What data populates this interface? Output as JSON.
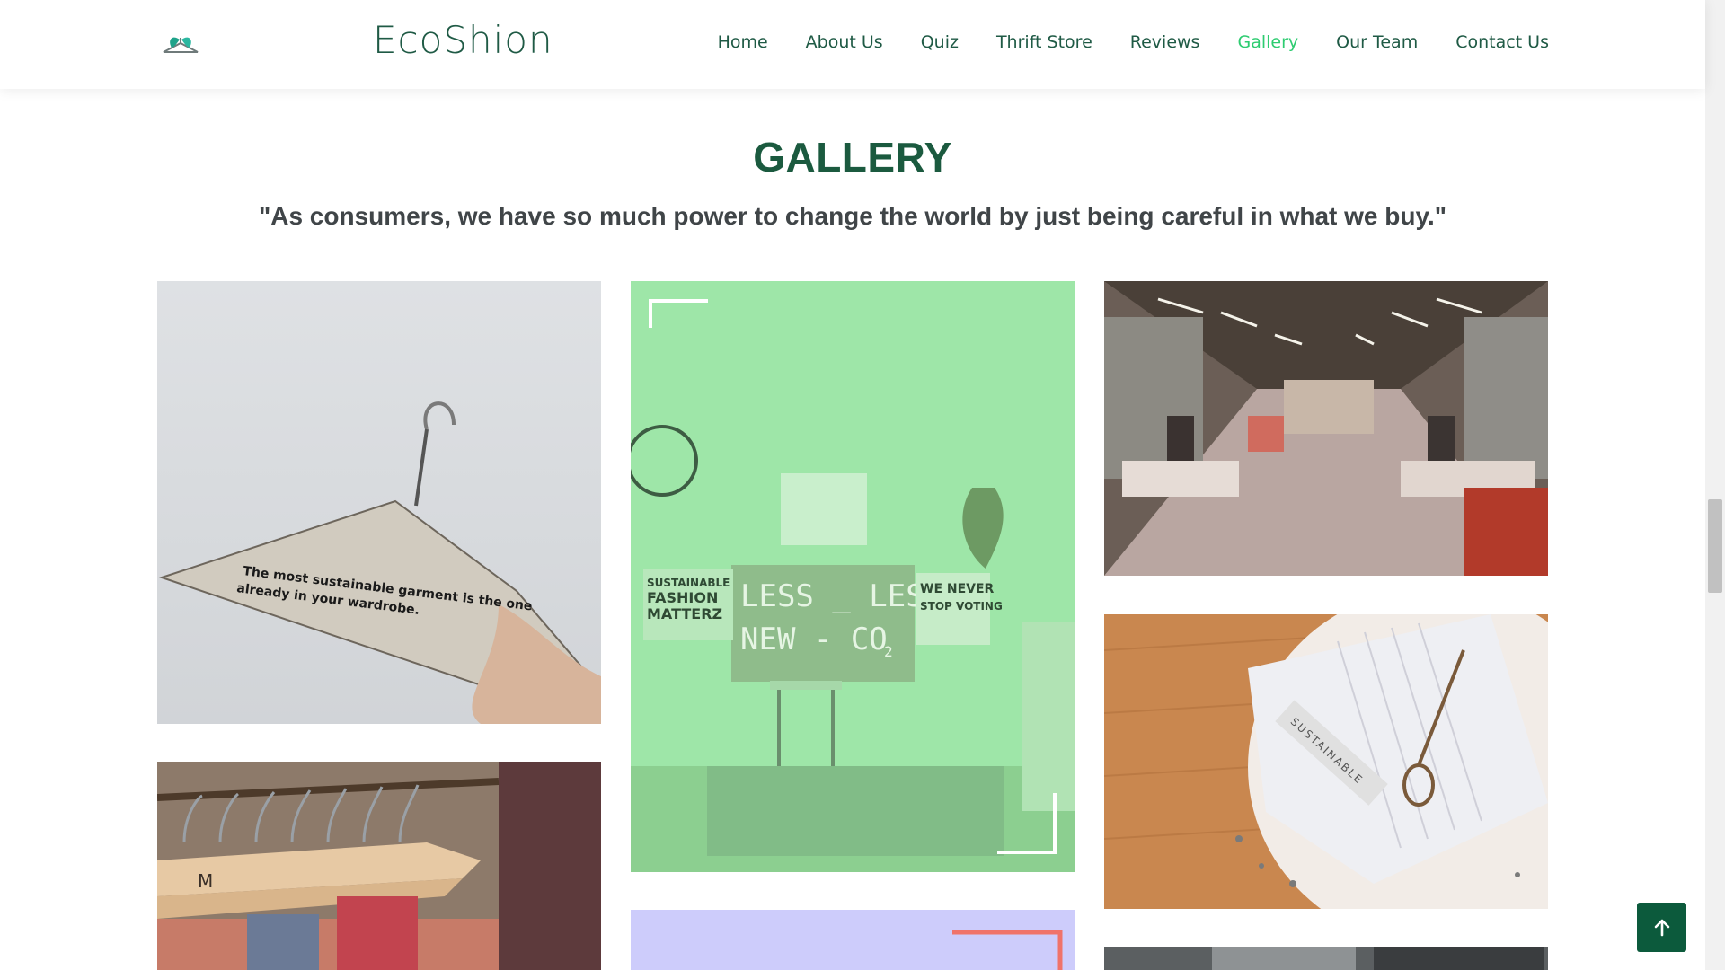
{
  "site": {
    "brand": "EcoShion",
    "logo_icon": "hanger-leaf-logo-icon"
  },
  "nav": {
    "items": [
      {
        "label": "Home",
        "active": false
      },
      {
        "label": "About Us",
        "active": false
      },
      {
        "label": "Quiz",
        "active": false
      },
      {
        "label": "Thrift Store",
        "active": false
      },
      {
        "label": "Reviews",
        "active": false
      },
      {
        "label": "Gallery",
        "active": true
      },
      {
        "label": "Our Team",
        "active": false
      },
      {
        "label": "Contact Us",
        "active": false
      }
    ]
  },
  "gallery": {
    "title": "GALLERY",
    "quote": "\"As consumers, we have so much power to change the world by just being careful in what we buy.\"",
    "tiles": {
      "hanger": {
        "caption_line1": "The most sustainable garment is the one",
        "caption_line2": "already in your wardrobe."
      },
      "protest": {
        "sign_main_line1": "LESS _ LESS",
        "sign_main_line2": "NEW - CO",
        "sign_main_sub": "2",
        "sign_left_line1": "SUSTAINABLE",
        "sign_left_line2": "FASHION",
        "sign_left_line3": "MATTERZ",
        "sign_right_line1": "WE NEVER",
        "sign_right_line2": "STOP VOTING"
      },
      "rack": {
        "letter": "M"
      },
      "tag": {
        "label": "SUSTAINABLE"
      }
    }
  },
  "colors": {
    "brand_green": "#1f5a45",
    "active_nav": "#2ecc71",
    "title_green": "#1b5a3f",
    "back_to_top": "#0c5a3c"
  },
  "back_to_top_icon": "arrow-up-icon"
}
